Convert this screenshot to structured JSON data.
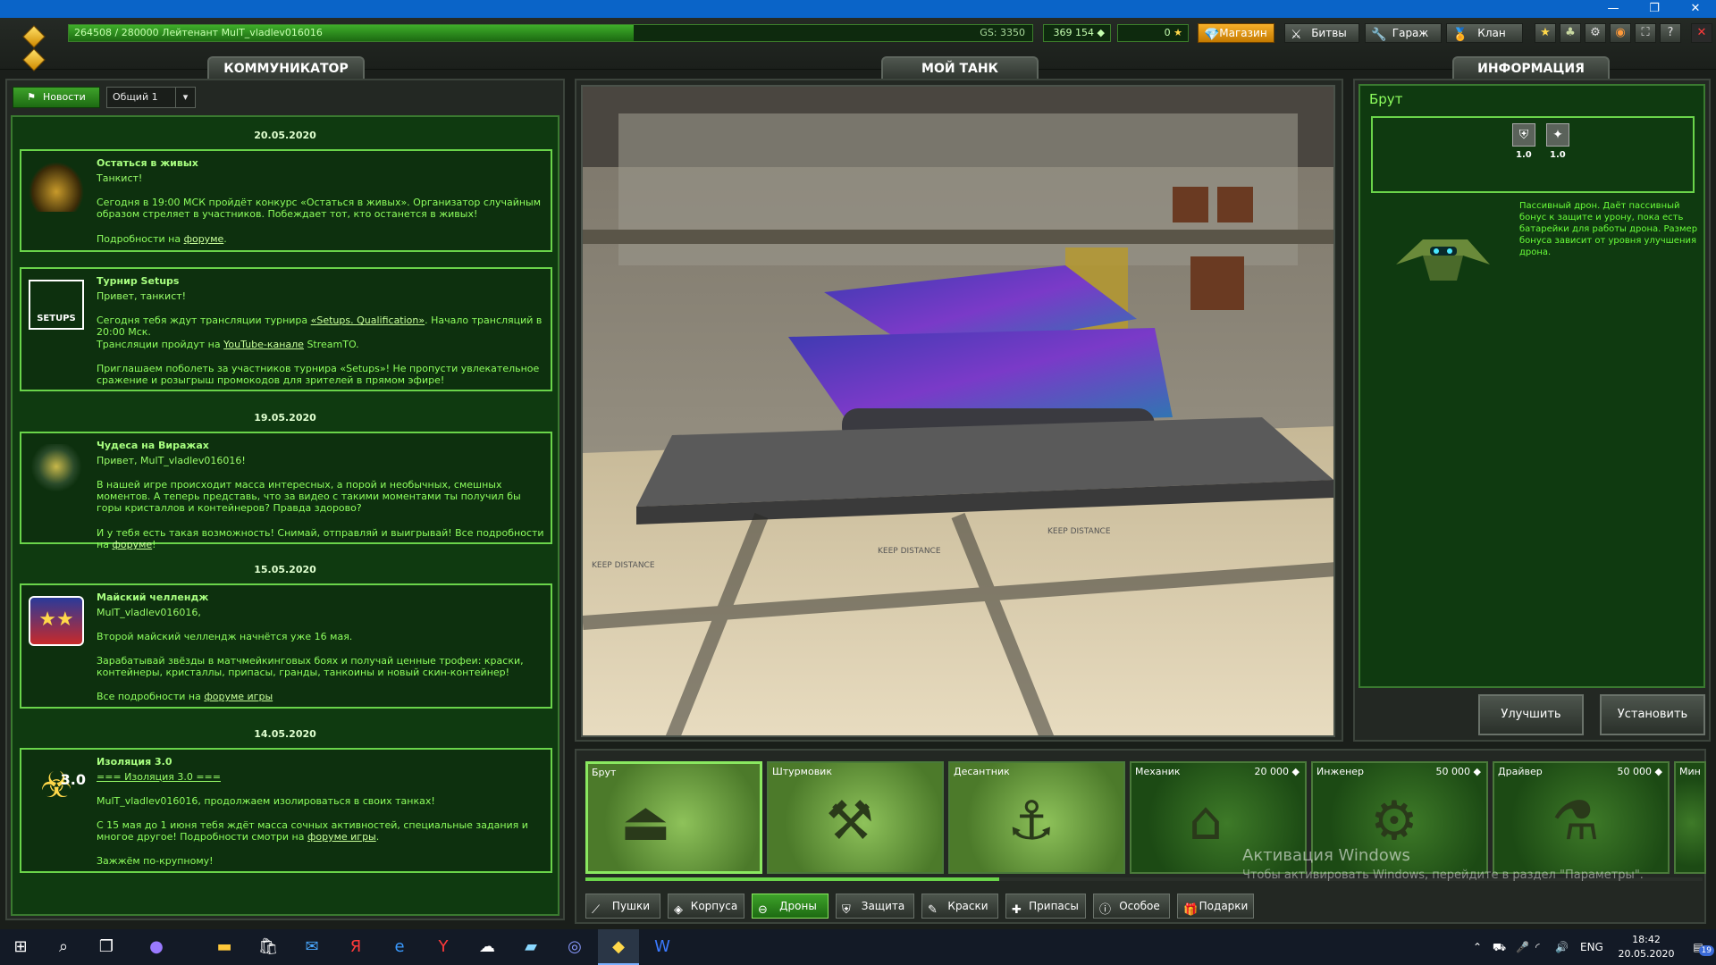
{
  "window": {
    "restore_icon": "restore-icon",
    "minimize_icon": "minimize-icon",
    "close_icon": "close-icon"
  },
  "topbar": {
    "rank_text": "264508 / 280000  Лейтенант MulT_vladlev016016",
    "rank_progress": 0.945,
    "gs": "GS: 3350",
    "crystals": "369 154",
    "stars": "0",
    "buttons": {
      "shop": "Магазин",
      "battles": "Битвы",
      "garage": "Гараж",
      "clan": "Клан"
    }
  },
  "communicator": {
    "tab": "КОММУНИКАТОР",
    "news_button": "Новости",
    "channel": "Общий 1",
    "groups": [
      {
        "date": "20.05.2020"
      },
      {
        "date": "19.05.2020"
      },
      {
        "date": "15.05.2020"
      },
      {
        "date": "14.05.2020"
      }
    ],
    "cards": [
      {
        "title": "Остаться в живых",
        "greeting": "Танкист!",
        "p1": "Сегодня в 19:00 МСК пройдёт конкурс «Остаться в живых». Организатор случайным образом стреляет в участников. Побеждает тот, кто останется в живых!",
        "p2": "Подробности на ",
        "link": "форуме",
        "p2_end": "."
      },
      {
        "title": "Турнир  Setups",
        "greeting": "Привет, танкист!",
        "p1": "Сегодня тебя ждут трансляции турнира ",
        "link1": "«Setups. Qualification»",
        "p1_end": ".  Начало трансляций в 20:00 Мск.",
        "p2": "Трансляции пройдут на ",
        "link2": "YouTube-канале",
        "p2_end": "  StreamTO.",
        "p3": "Приглашаем поболеть за участников турнира «Setups»! Не пропусти увлекательное сражение и розыгрыш промокодов для зрителей в прямом эфире!"
      },
      {
        "title": "Чудеса на Виражах",
        "greeting": "Привет, MulT_vladlev016016!",
        "p1": "В нашей игре происходит масса интересных, а порой и необычных, смешных моментов. А теперь представь, что за видео с такими моментами ты получил бы горы кристаллов и контейнеров? Правда здорово?",
        "p2": " И у тебя есть такая возможность! Снимай, отправляй и выигрывай! Все подробности на ",
        "link": "форуме",
        "p2_end": "!"
      },
      {
        "title": "Майский челлендж",
        "greeting": "MulT_vladlev016016,",
        "p1": "Второй майский челлендж начнётся уже 16 мая.",
        "p2": "Зарабатывай звёзды в матчмейкинговых боях и получай ценные трофеи: краски, контейнеры, кристаллы, припасы, гранды, танкоины и новый скин-контейнер!",
        "p3": "Все подробности на  ",
        "link": "форуме игры",
        "p3_end": ""
      },
      {
        "title": "Изоляция 3.0",
        "greeting_link": "=== Изоляция 3.0 ===",
        "p1": "MulT_vladlev016016, продолжаем изолироваться в своих танках!",
        "p2": "С 15 мая до 1 июня тебя ждёт масса сочных активностей, специальные задания и многое другое! Подробности смотри на ",
        "link": "форуме игры",
        "p2_end": ".",
        "p3": "Зажжём по-крупному!",
        "badge": "3.0"
      }
    ],
    "setups_logo": "SETUPS"
  },
  "tank": {
    "tab": "МОЙ ТАНК",
    "floor_text_1": "KEEP DISTANCE",
    "floor_text_2": "KEEP DISTANCE",
    "floor_text_3": "KEEP DISTANCE"
  },
  "info": {
    "tab": "ИНФОРМАЦИЯ",
    "item_name": "Брут",
    "stat1": "1.0",
    "stat2": "1.0",
    "description": "Пассивный дрон. Даёт пассивный бонус к защите и урону, пока есть батарейки для работы дрона. Размер бонуса зависит от уровня улучшения дрона.",
    "upgrade_button": "Улучшить",
    "install_button": "Установить"
  },
  "drones": [
    {
      "name": "Брут",
      "price": ""
    },
    {
      "name": "Штурмовик",
      "price": ""
    },
    {
      "name": "Десантник",
      "price": ""
    },
    {
      "name": "Механик",
      "price": "20 000"
    },
    {
      "name": "Инженер",
      "price": "50 000"
    },
    {
      "name": "Драйвер",
      "price": "50 000"
    },
    {
      "name": "Мин",
      "price": ""
    }
  ],
  "categories": [
    "Пушки",
    "Корпуса",
    "Дроны",
    "Защита",
    "Краски",
    "Припасы",
    "Особое",
    "Подарки"
  ],
  "watermark": {
    "title": "Активация Windows",
    "subtitle": "Чтобы активировать Windows, перейдите в раздел \"Параметры\"."
  },
  "taskbar": {
    "apps": [
      "start-icon",
      "search-icon",
      "task-view-icon",
      "cortana-icon",
      "file-explorer-icon",
      "store-icon",
      "mail-icon",
      "yandex-icon",
      "edge-icon",
      "yandex-browser-icon",
      "chat-icon",
      "notepad-icon",
      "discord-icon",
      "tanki-icon",
      "word-icon"
    ],
    "lang": "ENG",
    "time": "18:42",
    "date": "20.05.2020",
    "notifications": "19"
  },
  "colors": {
    "accent_green": "#3ea22a",
    "card_border": "#6ad44a",
    "text_green": "#8eff5e",
    "shop_orange": "#f6b02a"
  }
}
